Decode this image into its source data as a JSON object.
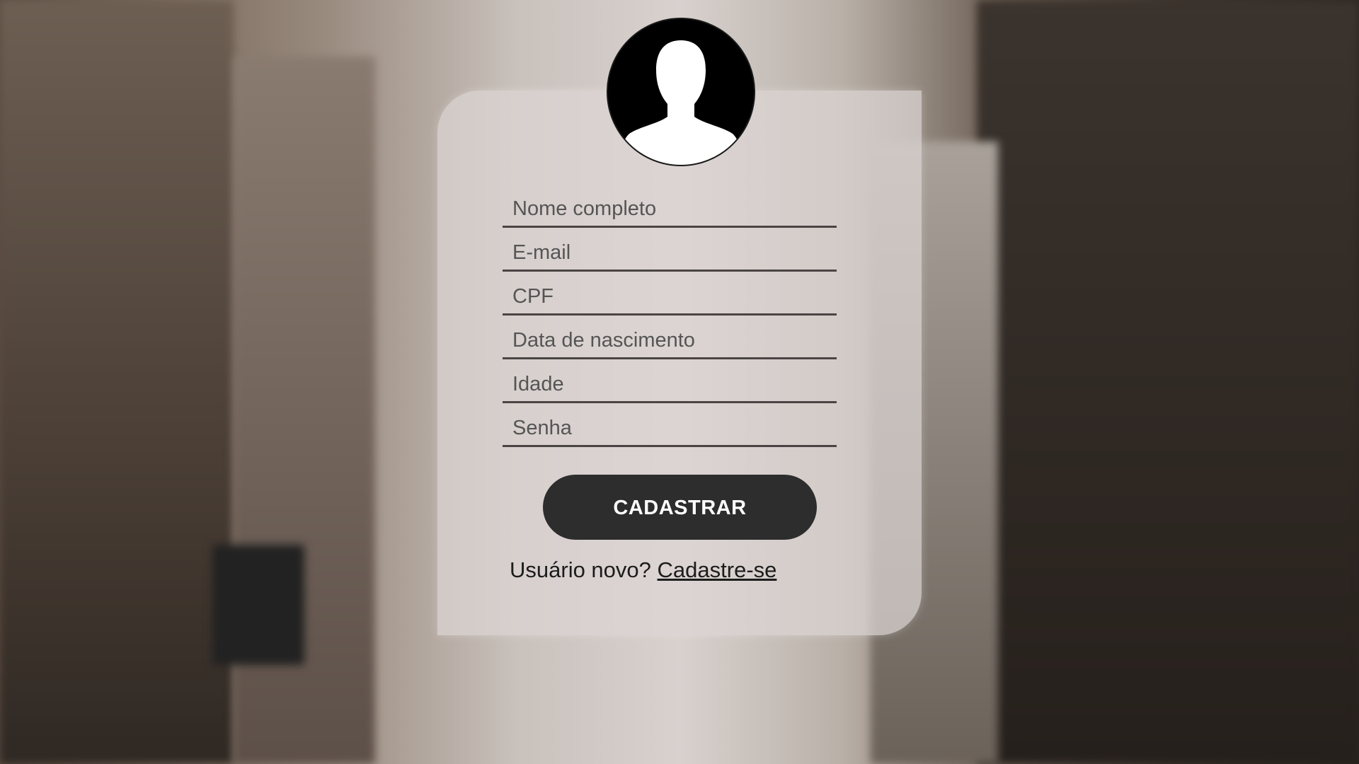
{
  "avatar": {
    "icon": "user-silhouette-icon"
  },
  "form": {
    "fields": [
      {
        "placeholder": "Nome completo",
        "value": ""
      },
      {
        "placeholder": "E-mail",
        "value": ""
      },
      {
        "placeholder": "CPF",
        "value": ""
      },
      {
        "placeholder": "Data de nascimento",
        "value": ""
      },
      {
        "placeholder": "Idade",
        "value": ""
      },
      {
        "placeholder": "Senha",
        "value": ""
      }
    ],
    "submit_label": "CADASTRAR"
  },
  "signup": {
    "prompt": "Usuário novo?",
    "link_label": "Cadastre-se"
  },
  "colors": {
    "button": "#2e2d2d",
    "card": "#dcd6d4",
    "field_underline": "#4a4444"
  }
}
